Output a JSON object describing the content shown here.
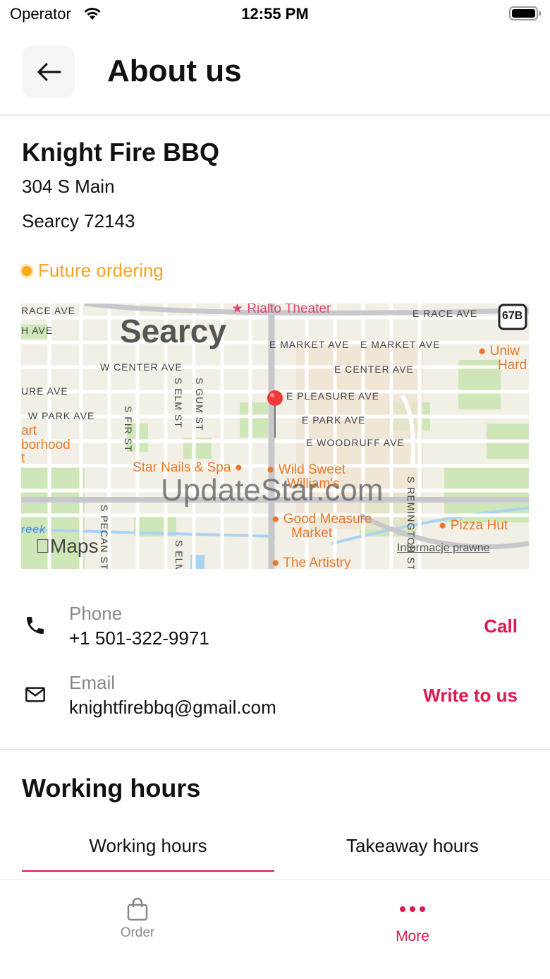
{
  "status_bar": {
    "carrier": "Operator",
    "time": "12:55 PM"
  },
  "header": {
    "title": "About us",
    "back_icon": "arrow-left-icon"
  },
  "restaurant": {
    "name": "Knight Fire BBQ",
    "address_line1": "304 S Main",
    "address_line2": "Searcy 72143",
    "status": "Future ordering",
    "status_color": "#f5a623"
  },
  "map": {
    "city": "Searcy",
    "streets": {
      "race_w": "RACE AVE",
      "h_ave": "H AVE",
      "e_race": "E RACE AVE",
      "e_market1": "E MARKET AVE",
      "e_market2": "E MARKET AVE",
      "w_center": "W CENTER AVE",
      "e_center": "E CENTER AVE",
      "ure_ave": "URE AVE",
      "e_pleasure": "E PLEASURE AVE",
      "w_park": "W PARK AVE",
      "e_park": "E PARK AVE",
      "e_woodruff": "E WOODRUFF AVE",
      "s_elm": "S ELM ST",
      "s_gum": "S GUM ST",
      "s_fir": "S FIR ST",
      "s_pecan": "S PECAN ST",
      "s_elm2": "S ELM",
      "s_remington": "S REMINGTON ST",
      "reek": "reek",
      "art": "art",
      "borhood": "borhood",
      "t": "t"
    },
    "route_shield": "67B",
    "pois": {
      "rialto": "Rialto Theater",
      "univ1": "Uniw",
      "univ2": "Hard",
      "star_nails": "Star Nails & Spa",
      "wild_sweet1": "Wild Sweet",
      "wild_sweet2": "William's",
      "good_measure1": "Good Measure",
      "good_measure2": "Market",
      "pizza_hut": "Pizza Hut",
      "artistry": "The Artistry"
    },
    "watermark": "UpdateStar.com",
    "maps_logo": "Maps",
    "legal": "Informacje prawne"
  },
  "contacts": {
    "phone": {
      "icon": "phone-icon",
      "label": "Phone",
      "value": "+1 501-322-9971",
      "action": "Call"
    },
    "email": {
      "icon": "mail-icon",
      "label": "Email",
      "value": "knightfirebbq@gmail.com",
      "action": "Write to us"
    }
  },
  "hours": {
    "title": "Working hours",
    "tabs": [
      {
        "label": "Working hours"
      },
      {
        "label": "Takeaway hours",
        "selected": true
      }
    ]
  },
  "bottom_nav": {
    "items": [
      {
        "label": "Order",
        "icon": "shopping-bag-icon"
      },
      {
        "label": "More",
        "icon": "more-dots-icon",
        "active": true
      }
    ]
  },
  "colors": {
    "accent": "#e0184d",
    "status": "#f5a623"
  }
}
